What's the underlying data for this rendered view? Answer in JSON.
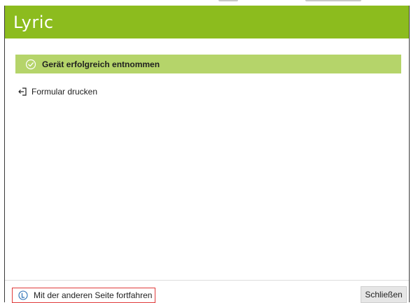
{
  "app": {
    "logo_text": "Lyric",
    "brand_color": "#8cbc1e"
  },
  "notification": {
    "icon": "check-circle-icon",
    "text": "Gerät erfolgreich entnommen",
    "color": "#b5d46a"
  },
  "actions": {
    "print_form": {
      "icon": "print-arrow-icon",
      "label": "Formular drucken"
    }
  },
  "footer": {
    "continue_button": {
      "icon": "l-circle-icon",
      "label": "Mit der anderen Seite fortfahren",
      "highlight_color": "#e03a3a"
    },
    "close_button": {
      "label": "Schließen"
    }
  }
}
